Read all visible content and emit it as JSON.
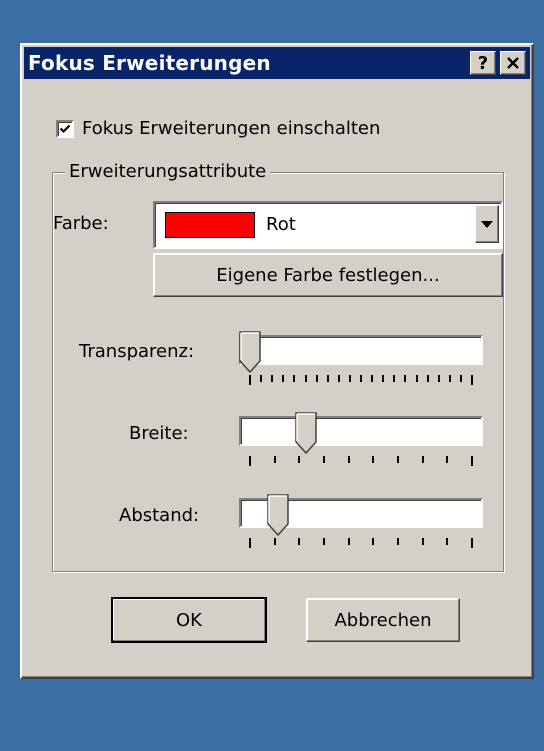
{
  "colors": {
    "desktop": "#3a6ea5",
    "titlebar": "#0a246a",
    "swatch": "#ff0000"
  },
  "window": {
    "title": "Fokus Erweiterungen",
    "help_label": "?",
    "close_icon": "close-icon"
  },
  "enable_checkbox": {
    "label": "Fokus Erweiterungen einschalten",
    "checked": true
  },
  "group": {
    "title": "Erweiterungsattribute"
  },
  "color": {
    "label": "Farbe:",
    "selected": "Rot",
    "custom_button": "Eigene Farbe festlegen..."
  },
  "sliders": {
    "transparency": {
      "label": "Transparenz:",
      "position": 0.0,
      "ticks": 21
    },
    "width": {
      "label": "Breite:",
      "position": 0.25,
      "ticks": 10
    },
    "spacing": {
      "label": "Abstand:",
      "position": 0.125,
      "ticks": 10
    }
  },
  "buttons": {
    "ok": "OK",
    "cancel": "Abbrechen"
  }
}
